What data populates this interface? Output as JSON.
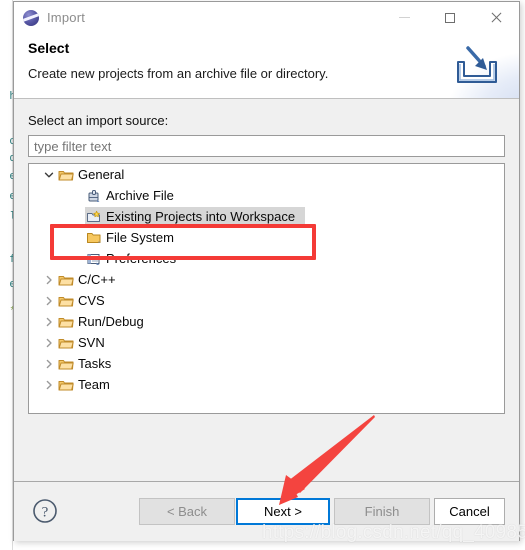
{
  "window": {
    "title": "Import",
    "app_icon": "eclipse-sphere-icon",
    "controls": {
      "minimize": "minimize-icon",
      "maximize": "maximize-icon",
      "close": "close-icon"
    }
  },
  "header": {
    "title": "Select",
    "description": "Create new projects from an archive file or directory.",
    "banner_icon": "import-tray-arrow-icon"
  },
  "content": {
    "source_label": "Select an import source:",
    "filter": {
      "value": "",
      "placeholder": "type filter text"
    },
    "tree": [
      {
        "label": "General",
        "depth": 1,
        "icon": "folder-icon",
        "twisty": "chevron-down-icon",
        "expanded": true,
        "selected": false
      },
      {
        "label": "Archive File",
        "depth": 2,
        "icon": "archive-file-icon",
        "twisty": "",
        "expanded": false,
        "selected": false
      },
      {
        "label": "Existing Projects into Workspace",
        "depth": 2,
        "icon": "existing-project-icon",
        "twisty": "",
        "expanded": false,
        "selected": true
      },
      {
        "label": "File System",
        "depth": 2,
        "icon": "file-system-folder-icon",
        "twisty": "",
        "expanded": false,
        "selected": false
      },
      {
        "label": "Preferences",
        "depth": 2,
        "icon": "preferences-icon",
        "twisty": "",
        "expanded": false,
        "selected": false
      },
      {
        "label": "C/C++",
        "depth": 1,
        "icon": "folder-icon",
        "twisty": "chevron-right-icon",
        "expanded": false,
        "selected": false
      },
      {
        "label": "CVS",
        "depth": 1,
        "icon": "folder-icon",
        "twisty": "chevron-right-icon",
        "expanded": false,
        "selected": false
      },
      {
        "label": "Run/Debug",
        "depth": 1,
        "icon": "folder-icon",
        "twisty": "chevron-right-icon",
        "expanded": false,
        "selected": false
      },
      {
        "label": "SVN",
        "depth": 1,
        "icon": "folder-icon",
        "twisty": "chevron-right-icon",
        "expanded": false,
        "selected": false
      },
      {
        "label": "Tasks",
        "depth": 1,
        "icon": "folder-icon",
        "twisty": "chevron-right-icon",
        "expanded": false,
        "selected": false
      },
      {
        "label": "Team",
        "depth": 1,
        "icon": "folder-icon",
        "twisty": "chevron-right-icon",
        "expanded": false,
        "selected": false
      }
    ]
  },
  "buttons": {
    "help": "help-icon",
    "back": {
      "label": "< Back",
      "state": "disabled"
    },
    "next": {
      "label": "Next >",
      "state": "focused"
    },
    "finish": {
      "label": "Finish",
      "state": "disabled"
    },
    "cancel": {
      "label": "Cancel",
      "state": "enabled"
    }
  },
  "annotations": {
    "highlight_color": "#f43a36",
    "focus_color": "#0078d7",
    "highlighted_item": "Existing Projects into Workspace",
    "arrow_target": "Next >"
  },
  "watermark": "https://blog.csdn.net/qq_40985093",
  "background": {
    "code_fragment_lines": [
      "h",
      "o",
      "d",
      "e",
      "e",
      "l",
      "f",
      "e",
      "*"
    ]
  }
}
